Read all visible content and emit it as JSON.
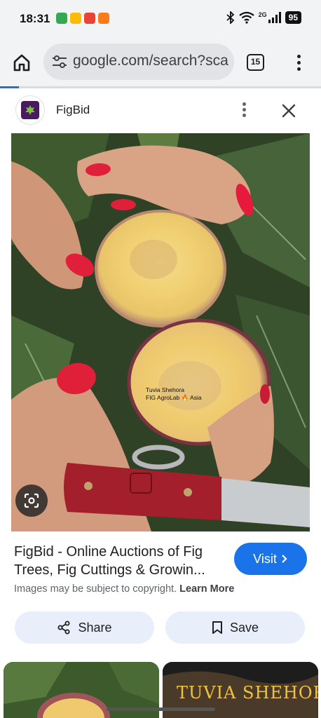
{
  "status_bar": {
    "time": "18:31",
    "network": "2G",
    "battery": "95"
  },
  "browser": {
    "url": "google.com/search?sca",
    "tab_count": "15",
    "load_progress": 0.06
  },
  "site": {
    "name": "FigBid"
  },
  "image": {
    "watermark_line1": "Tuvia Shehora",
    "watermark_line2": "FIG AgroLab 🔥 Asia"
  },
  "result": {
    "title": "FigBid - Online Auctions of Fig Trees, Fig Cuttings & Growin...",
    "visit_label": "Visit",
    "copyright_text": "Images may be subject to copyright.",
    "learn_more": "Learn More"
  },
  "actions": {
    "share_label": "Share",
    "save_label": "Save"
  },
  "related": {
    "thumb2_text": "TUVIA SHEHORA"
  },
  "colors": {
    "accent": "#1a73e8",
    "action_bg": "#e8effa",
    "chrome_bg": "#f1f3f4"
  }
}
